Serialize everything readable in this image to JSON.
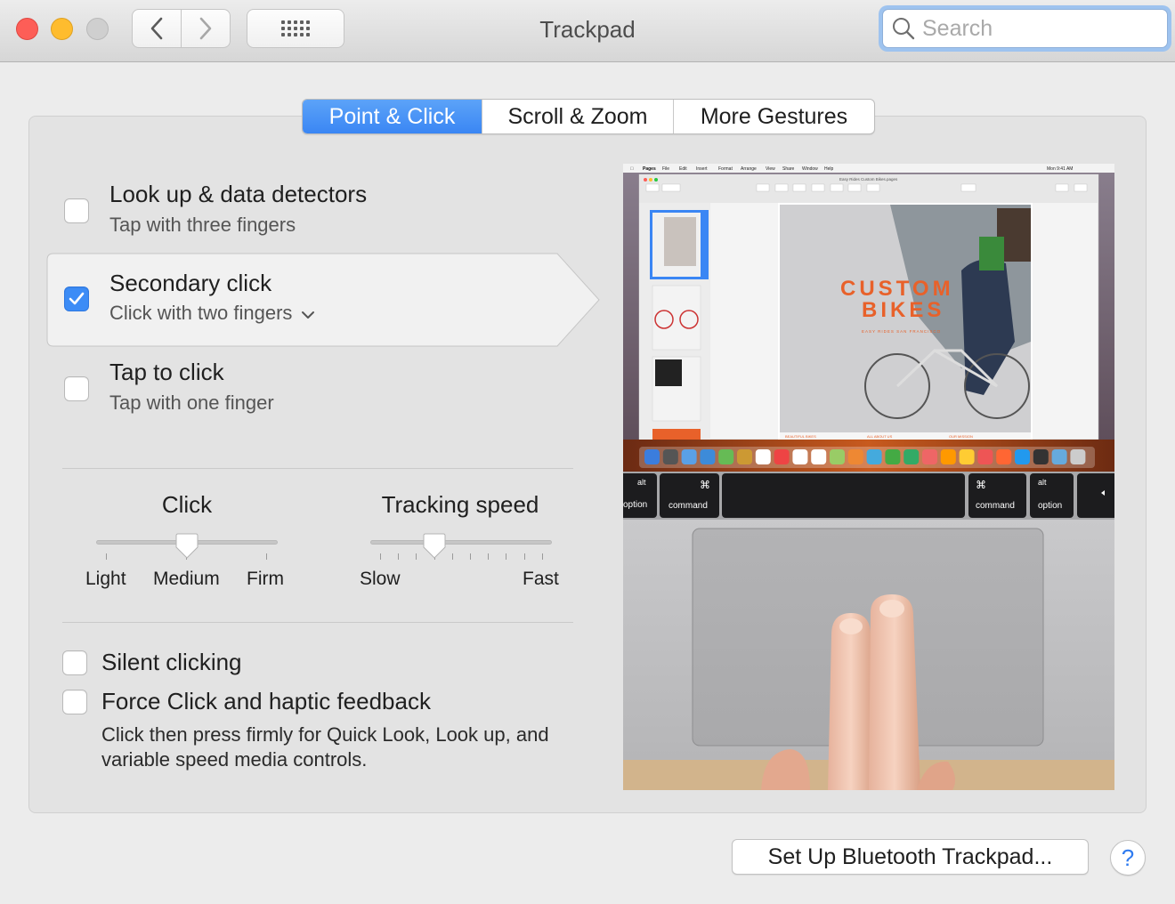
{
  "window": {
    "title": "Trackpad"
  },
  "toolbar": {
    "back_icon": "chevron-left-icon",
    "forward_icon": "chevron-right-icon",
    "show_all_icon": "grid-icon"
  },
  "search": {
    "placeholder": "Search",
    "value": ""
  },
  "tabs": [
    {
      "label": "Point & Click",
      "active": true
    },
    {
      "label": "Scroll & Zoom",
      "active": false
    },
    {
      "label": "More Gestures",
      "active": false
    }
  ],
  "options": [
    {
      "title": "Look up & data detectors",
      "subtitle": "Tap with three fingers",
      "checked": false
    },
    {
      "title": "Secondary click",
      "subtitle": "Click with two fingers",
      "checked": true,
      "selected": true
    },
    {
      "title": "Tap to click",
      "subtitle": "Tap with one finger",
      "checked": false
    }
  ],
  "sliders": {
    "click": {
      "title": "Click",
      "labels": [
        "Light",
        "Medium",
        "Firm"
      ],
      "value": "Medium"
    },
    "tracking": {
      "title": "Tracking speed",
      "min_label": "Slow",
      "max_label": "Fast",
      "level": 0.3
    }
  },
  "bottom_options": {
    "silent": {
      "label": "Silent clicking",
      "checked": false
    },
    "force": {
      "label": "Force Click and haptic feedback",
      "checked": false,
      "description": "Click then press firmly for Quick Look, Look up, and variable speed media controls."
    }
  },
  "preview": {
    "menubar_app": "Pages",
    "menubar_items": [
      "File",
      "Edit",
      "Insert",
      "Format",
      "Arrange",
      "View",
      "Share",
      "Window",
      "Help"
    ],
    "menubar_clock": "Mon 9:41 AM",
    "doc_title": "Easy Rides Custom Bikes.pages",
    "headline_1": "CUSTOM",
    "headline_2": "BIKES",
    "tagline": "EASY RIDES SAN FRANCISCO",
    "footer": [
      "BEAUTIFUL BIKES",
      "ALL ABOUT US",
      "OUR MISSION"
    ],
    "keys": {
      "alt_left": "alt",
      "option_left": "option",
      "cmd_symbol": "⌘",
      "command_left": "command",
      "command_right": "command",
      "alt_right": "alt",
      "option_right": "option"
    }
  },
  "footer": {
    "setup_button": "Set Up Bluetooth Trackpad...",
    "help_button": "?"
  },
  "colors": {
    "accent": "#3c8cf6",
    "title_orange": "#e8612a",
    "close": "#fd5e57",
    "minimize": "#febc2e"
  }
}
